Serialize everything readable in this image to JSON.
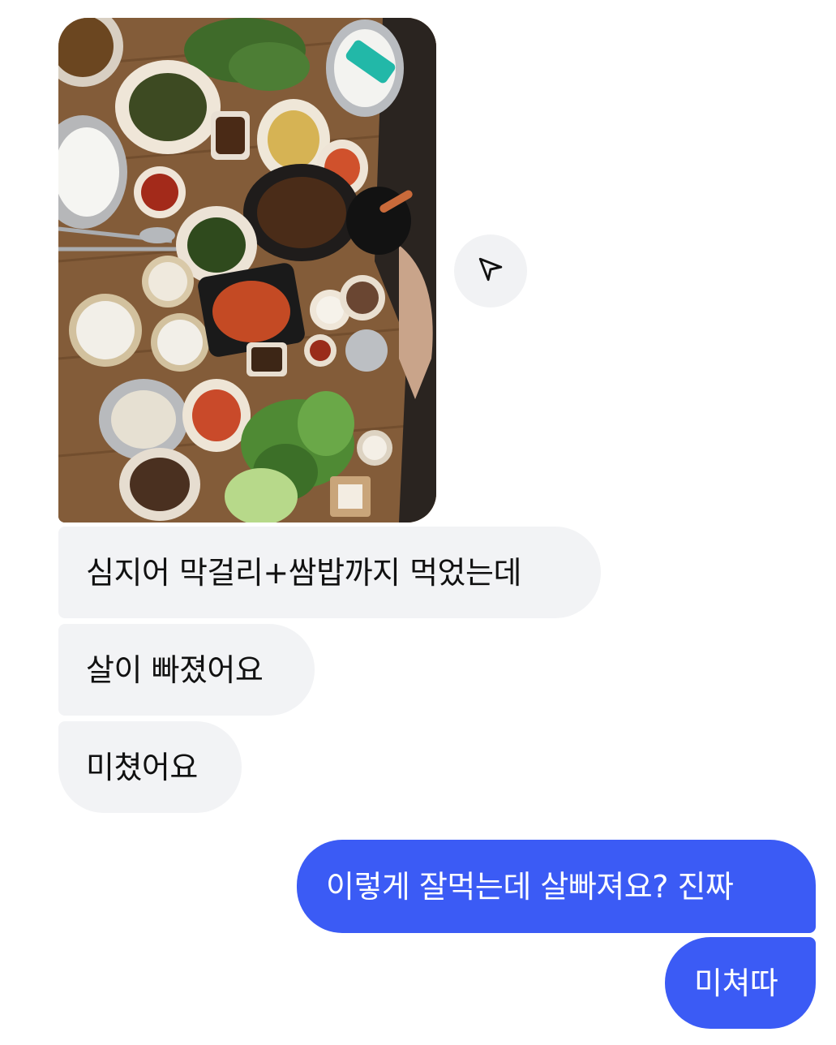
{
  "conversation": {
    "received": [
      {
        "text": "심지어 막걸리+쌈밥까지 먹었는데"
      },
      {
        "text": "살이 빠졌어요"
      },
      {
        "text": "미쳤어요"
      }
    ],
    "sent": [
      {
        "text": "이렇게 잘먹는데 살빠져요? 진짜"
      },
      {
        "text": "미쳐따"
      }
    ]
  },
  "icons": {
    "share": "paper-plane-icon"
  },
  "colors": {
    "sent_bubble": "#3b5bf5",
    "received_bubble": "#f2f3f5",
    "share_button_bg": "#f1f2f4"
  }
}
